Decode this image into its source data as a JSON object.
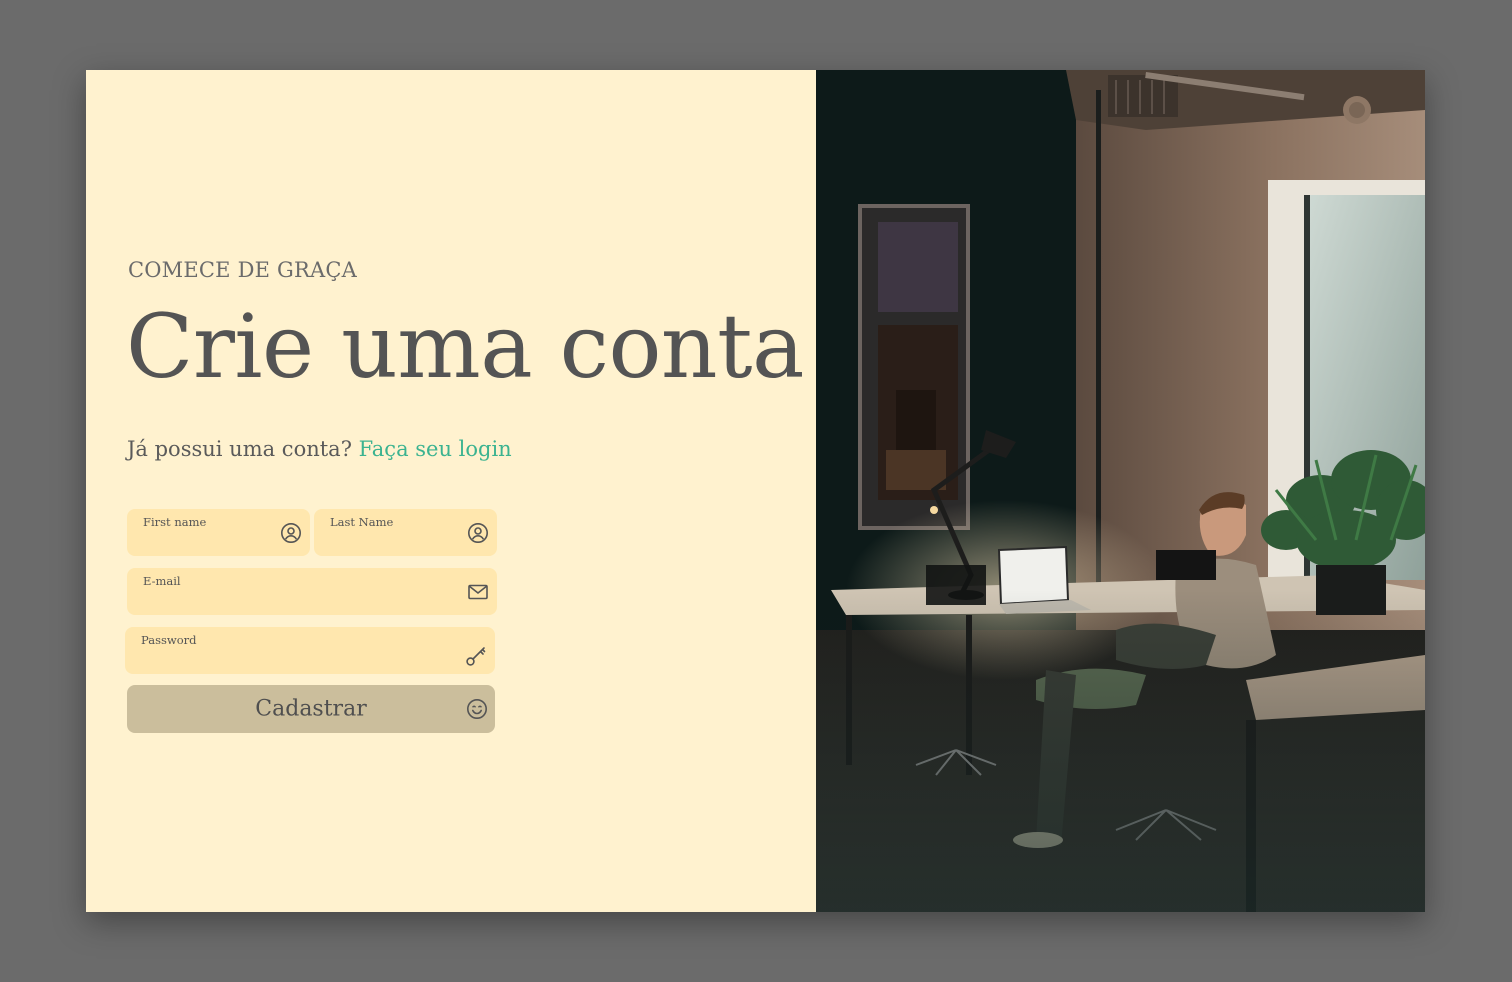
{
  "hero": {
    "eyebrow": "COMECE DE GRAÇA",
    "title": "Crie uma conta",
    "subtitle_prefix": "Já possui uma conta? ",
    "login_link": "Faça seu login"
  },
  "form": {
    "first_name": {
      "label": "First name",
      "value": "",
      "icon": "user-circle-icon"
    },
    "last_name": {
      "label": "Last Name",
      "value": "",
      "icon": "user-circle-icon"
    },
    "email": {
      "label": "E-mail",
      "value": "",
      "icon": "envelope-icon"
    },
    "password": {
      "label": "Password",
      "value": "",
      "icon": "key-icon"
    },
    "submit": {
      "label": "Cadastrar",
      "icon": "smiley-icon"
    }
  },
  "colors": {
    "panel_bg": "#fff2cf",
    "field_bg": "#ffe7ae",
    "button_bg": "#cbbe9c",
    "link": "#3bb390",
    "text": "#545454",
    "backdrop": "#6b6b6b"
  }
}
